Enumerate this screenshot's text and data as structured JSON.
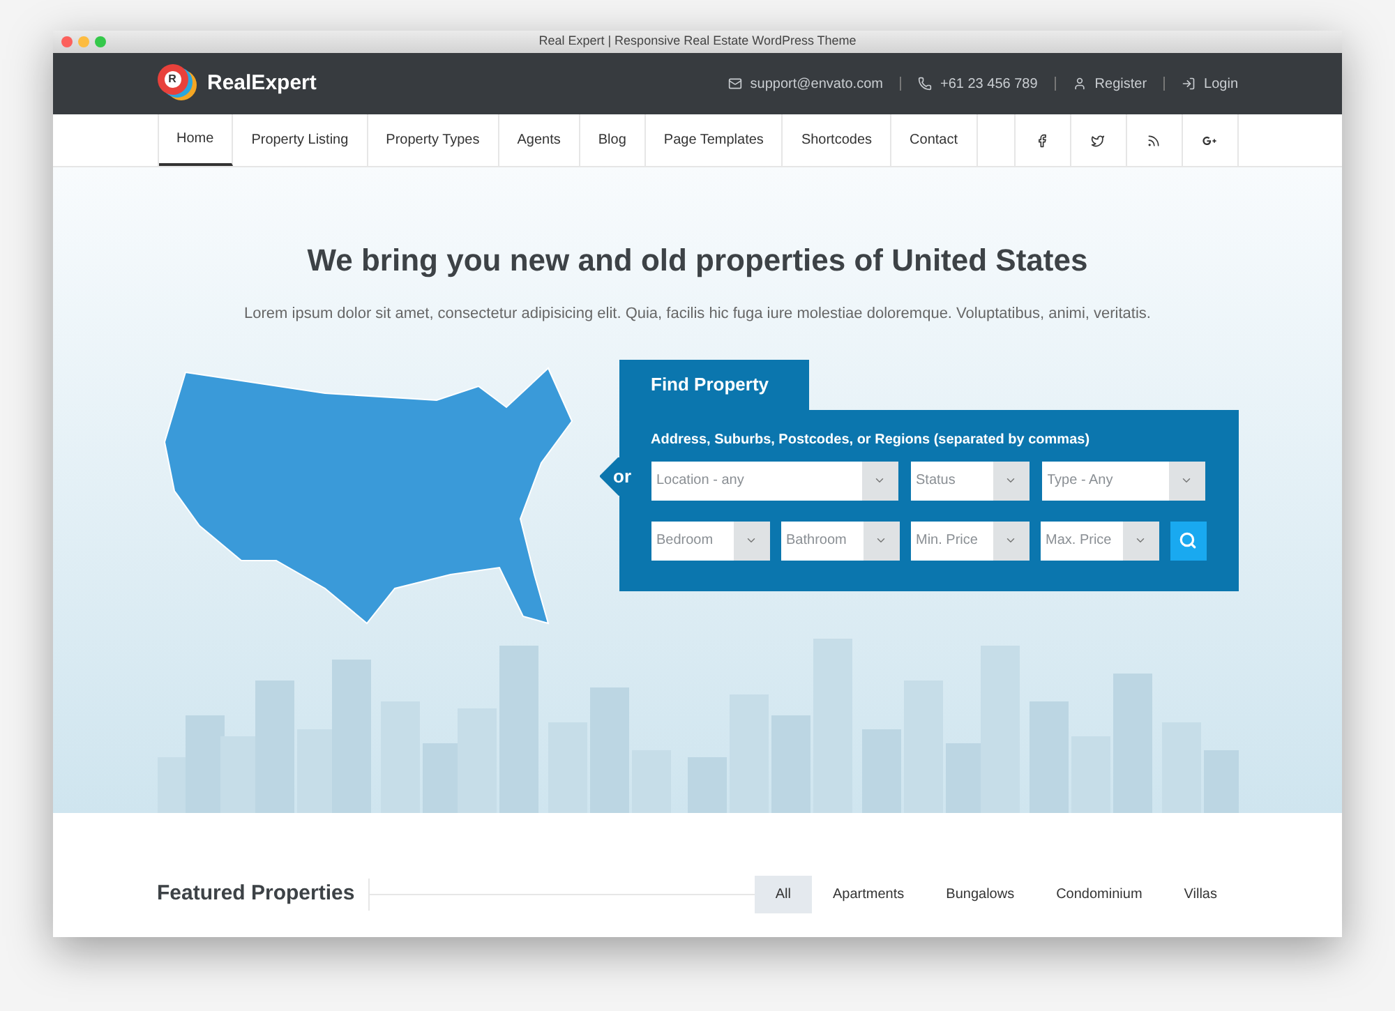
{
  "window": {
    "title": "Real Expert | Responsive Real Estate WordPress Theme"
  },
  "header": {
    "logo_letter": "R",
    "brand": "RealExpert",
    "contacts": [
      {
        "kind": "email",
        "label": "support@envato.com"
      },
      {
        "kind": "phone",
        "label": "+61 23 456 789"
      },
      {
        "kind": "register",
        "label": "Register"
      },
      {
        "kind": "login",
        "label": "Login"
      }
    ]
  },
  "nav": {
    "items": [
      {
        "label": "Home",
        "selected": true
      },
      {
        "label": "Property Listing",
        "selected": false
      },
      {
        "label": "Property Types",
        "selected": false
      },
      {
        "label": "Agents",
        "selected": false
      },
      {
        "label": "Blog",
        "selected": false
      },
      {
        "label": "Page Templates",
        "selected": false
      },
      {
        "label": "Shortcodes",
        "selected": false
      },
      {
        "label": "Contact",
        "selected": false
      }
    ],
    "social": [
      {
        "kind": "facebook"
      },
      {
        "kind": "twitter"
      },
      {
        "kind": "rss"
      },
      {
        "kind": "googleplus"
      }
    ]
  },
  "hero": {
    "title": "We bring you new and old properties of United States",
    "text": "Lorem ipsum dolor sit amet, consectetur adipisicing elit. Quia, facilis hic fuga iure molestiae doloremque. Voluptatibus, animi, veritatis.",
    "or": "or"
  },
  "search": {
    "tab": "Find Property",
    "label": "Address, Suburbs, Postcodes, or Regions (separated by commas)",
    "row_1": [
      {
        "placeholder": "Location - any"
      },
      {
        "placeholder": "Status"
      },
      {
        "placeholder": "Type - Any"
      }
    ],
    "row_2": [
      {
        "placeholder": "Bedroom"
      },
      {
        "placeholder": "Bathroom"
      },
      {
        "placeholder": "Min. Price"
      },
      {
        "placeholder": "Max. Price"
      }
    ]
  },
  "featured": {
    "title": "Featured Properties",
    "filters": [
      {
        "label": "All",
        "selected": true
      },
      {
        "label": "Apartments",
        "selected": false
      },
      {
        "label": "Bungalows",
        "selected": false
      },
      {
        "label": "Condominium",
        "selected": false
      },
      {
        "label": "Villas",
        "selected": false
      }
    ]
  }
}
